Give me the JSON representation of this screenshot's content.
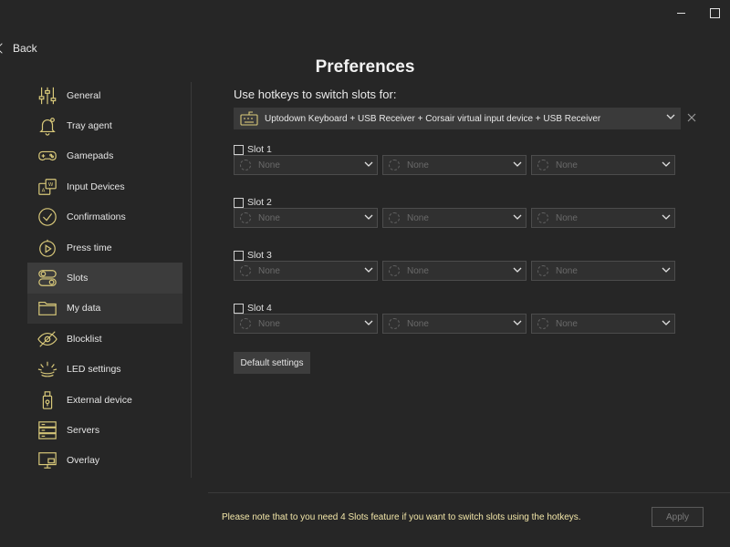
{
  "window": {
    "back_label": "Back",
    "title": "Preferences"
  },
  "sidebar": {
    "items": [
      {
        "label": "General",
        "icon": "sliders-icon"
      },
      {
        "label": "Tray agent",
        "icon": "bell-icon"
      },
      {
        "label": "Gamepads",
        "icon": "gamepad-icon"
      },
      {
        "label": "Input Devices",
        "icon": "input-devices-icon"
      },
      {
        "label": "Confirmations",
        "icon": "check-circle-icon"
      },
      {
        "label": "Press time",
        "icon": "stopwatch-icon"
      },
      {
        "label": "Slots",
        "icon": "toggles-icon",
        "selected": true
      },
      {
        "label": "My data",
        "icon": "folder-icon"
      },
      {
        "label": "Blocklist",
        "icon": "eye-off-icon"
      },
      {
        "label": "LED settings",
        "icon": "led-icon"
      },
      {
        "label": "External device",
        "icon": "usb-device-icon"
      },
      {
        "label": "Servers",
        "icon": "servers-icon"
      },
      {
        "label": "Overlay",
        "icon": "monitor-icon"
      }
    ]
  },
  "main": {
    "hotkey_label": "Use hotkeys to switch slots for:",
    "device_select": {
      "value": "Uptodown Keyboard + USB Receiver + Corsair virtual input device + USB Receiver"
    },
    "slots": [
      {
        "label": "Slot 1",
        "options": [
          "None",
          "None",
          "None"
        ]
      },
      {
        "label": "Slot 2",
        "options": [
          "None",
          "None",
          "None"
        ]
      },
      {
        "label": "Slot 3",
        "options": [
          "None",
          "None",
          "None"
        ]
      },
      {
        "label": "Slot 4",
        "options": [
          "None",
          "None",
          "None"
        ]
      }
    ],
    "default_button": "Default settings"
  },
  "footer": {
    "note": "Please note that to you need 4 Slots feature if you want to switch slots using the hotkeys.",
    "apply_label": "Apply"
  },
  "colors": {
    "icon_accent": "#d9c97a",
    "background": "#262626",
    "selected_item": "#3c3c3c",
    "note_text": "#f2e6a8"
  }
}
